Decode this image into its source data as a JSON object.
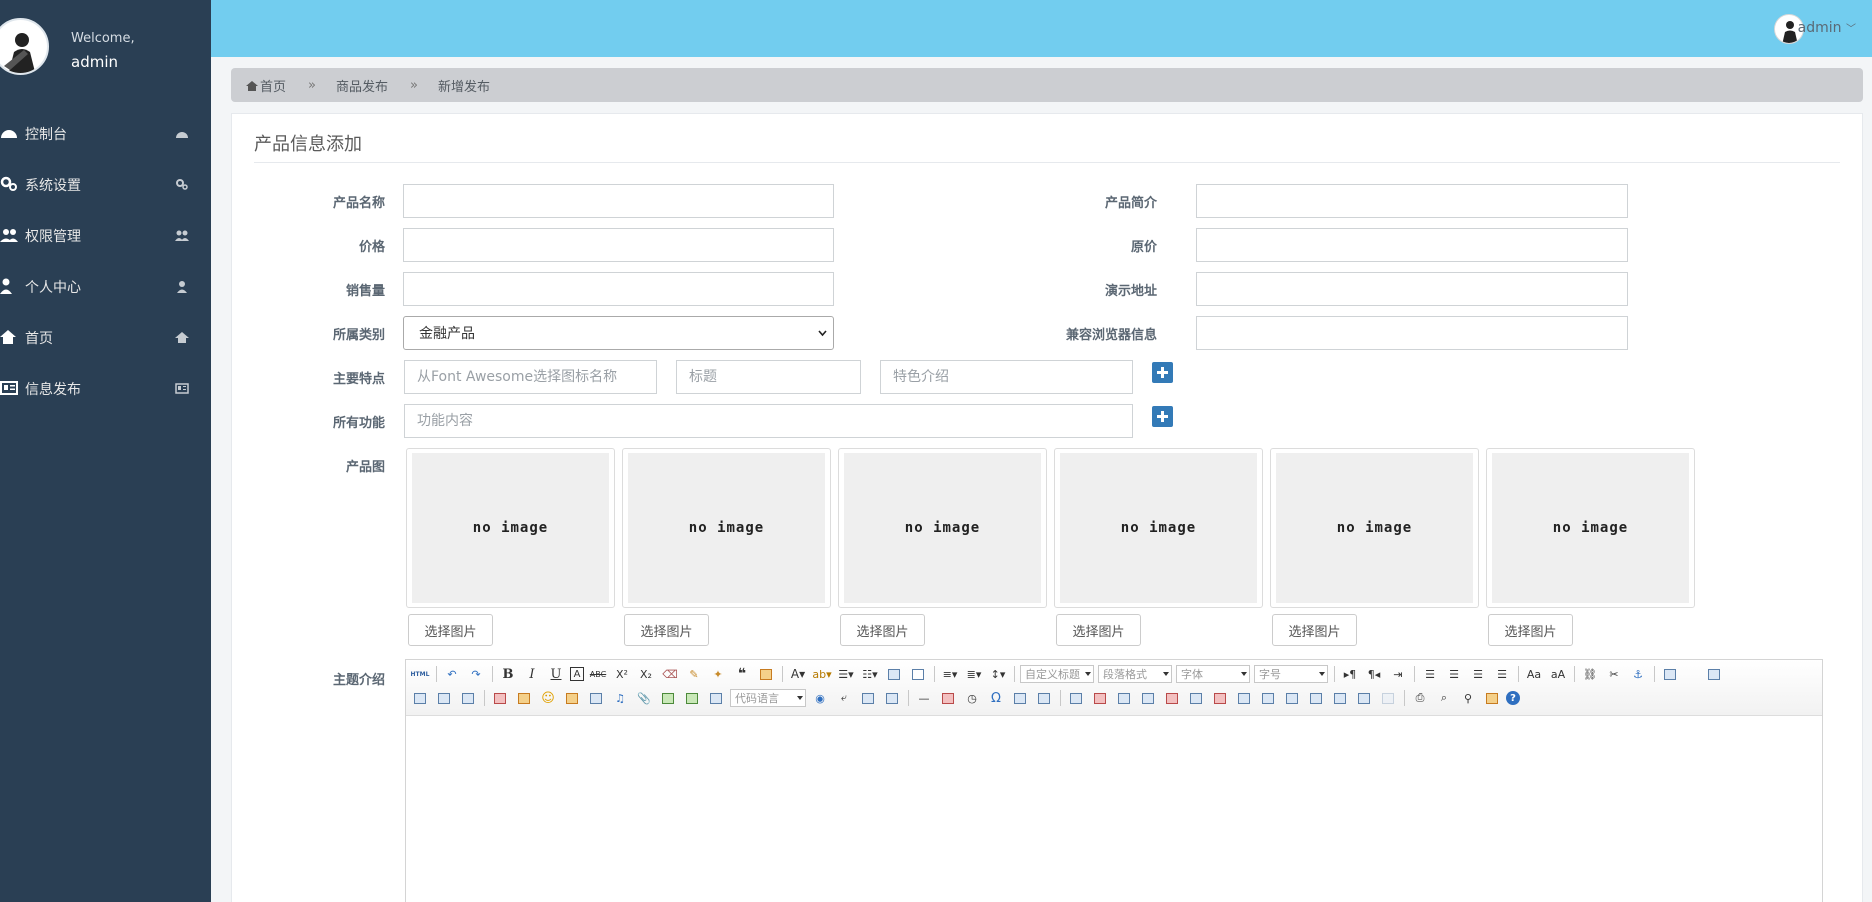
{
  "sidebar": {
    "welcome": "Welcome,",
    "username": "admin",
    "items": [
      {
        "label": "控制台",
        "icon": "dashboard-icon"
      },
      {
        "label": "系统设置",
        "icon": "cogs-icon"
      },
      {
        "label": "权限管理",
        "icon": "users-icon"
      },
      {
        "label": "个人中心",
        "icon": "user-icon"
      },
      {
        "label": "首页",
        "icon": "home-icon"
      },
      {
        "label": "信息发布",
        "icon": "newspaper-icon"
      }
    ]
  },
  "topbar": {
    "username": "admin"
  },
  "breadcrumb": [
    "首页",
    "商品发布",
    "新增发布"
  ],
  "breadcrumb_separator": "»",
  "panel": {
    "title": "产品信息添加"
  },
  "form": {
    "labels": {
      "name": "产品名称",
      "intro": "产品简介",
      "price": "价格",
      "original_price": "原价",
      "sales": "销售量",
      "demo_url": "演示地址",
      "category": "所属类别",
      "browser": "兼容浏览器信息",
      "features": "主要特点",
      "functions": "所有功能",
      "images": "产品图",
      "topic": "主题介绍"
    },
    "category_value": "金融产品",
    "placeholders": {
      "feature_icon": "从Font Awesome选择图标名称",
      "feature_title": "标题",
      "feature_desc": "特色介绍",
      "function_content": "功能内容"
    },
    "image_slots": [
      {
        "text": "no image",
        "button": "选择图片"
      },
      {
        "text": "no image",
        "button": "选择图片"
      },
      {
        "text": "no image",
        "button": "选择图片"
      },
      {
        "text": "no image",
        "button": "选择图片"
      },
      {
        "text": "no image",
        "button": "选择图片"
      },
      {
        "text": "no image",
        "button": "选择图片"
      }
    ]
  },
  "editor": {
    "selects": {
      "heading": "自定义标题",
      "paragraph": "段落格式",
      "font": "字体",
      "size": "字号",
      "code_lang": "代码语言"
    }
  },
  "colors": {
    "sidebar": "#2a3f54",
    "topbar": "#72cdef",
    "primary_button": "#337ab7"
  }
}
